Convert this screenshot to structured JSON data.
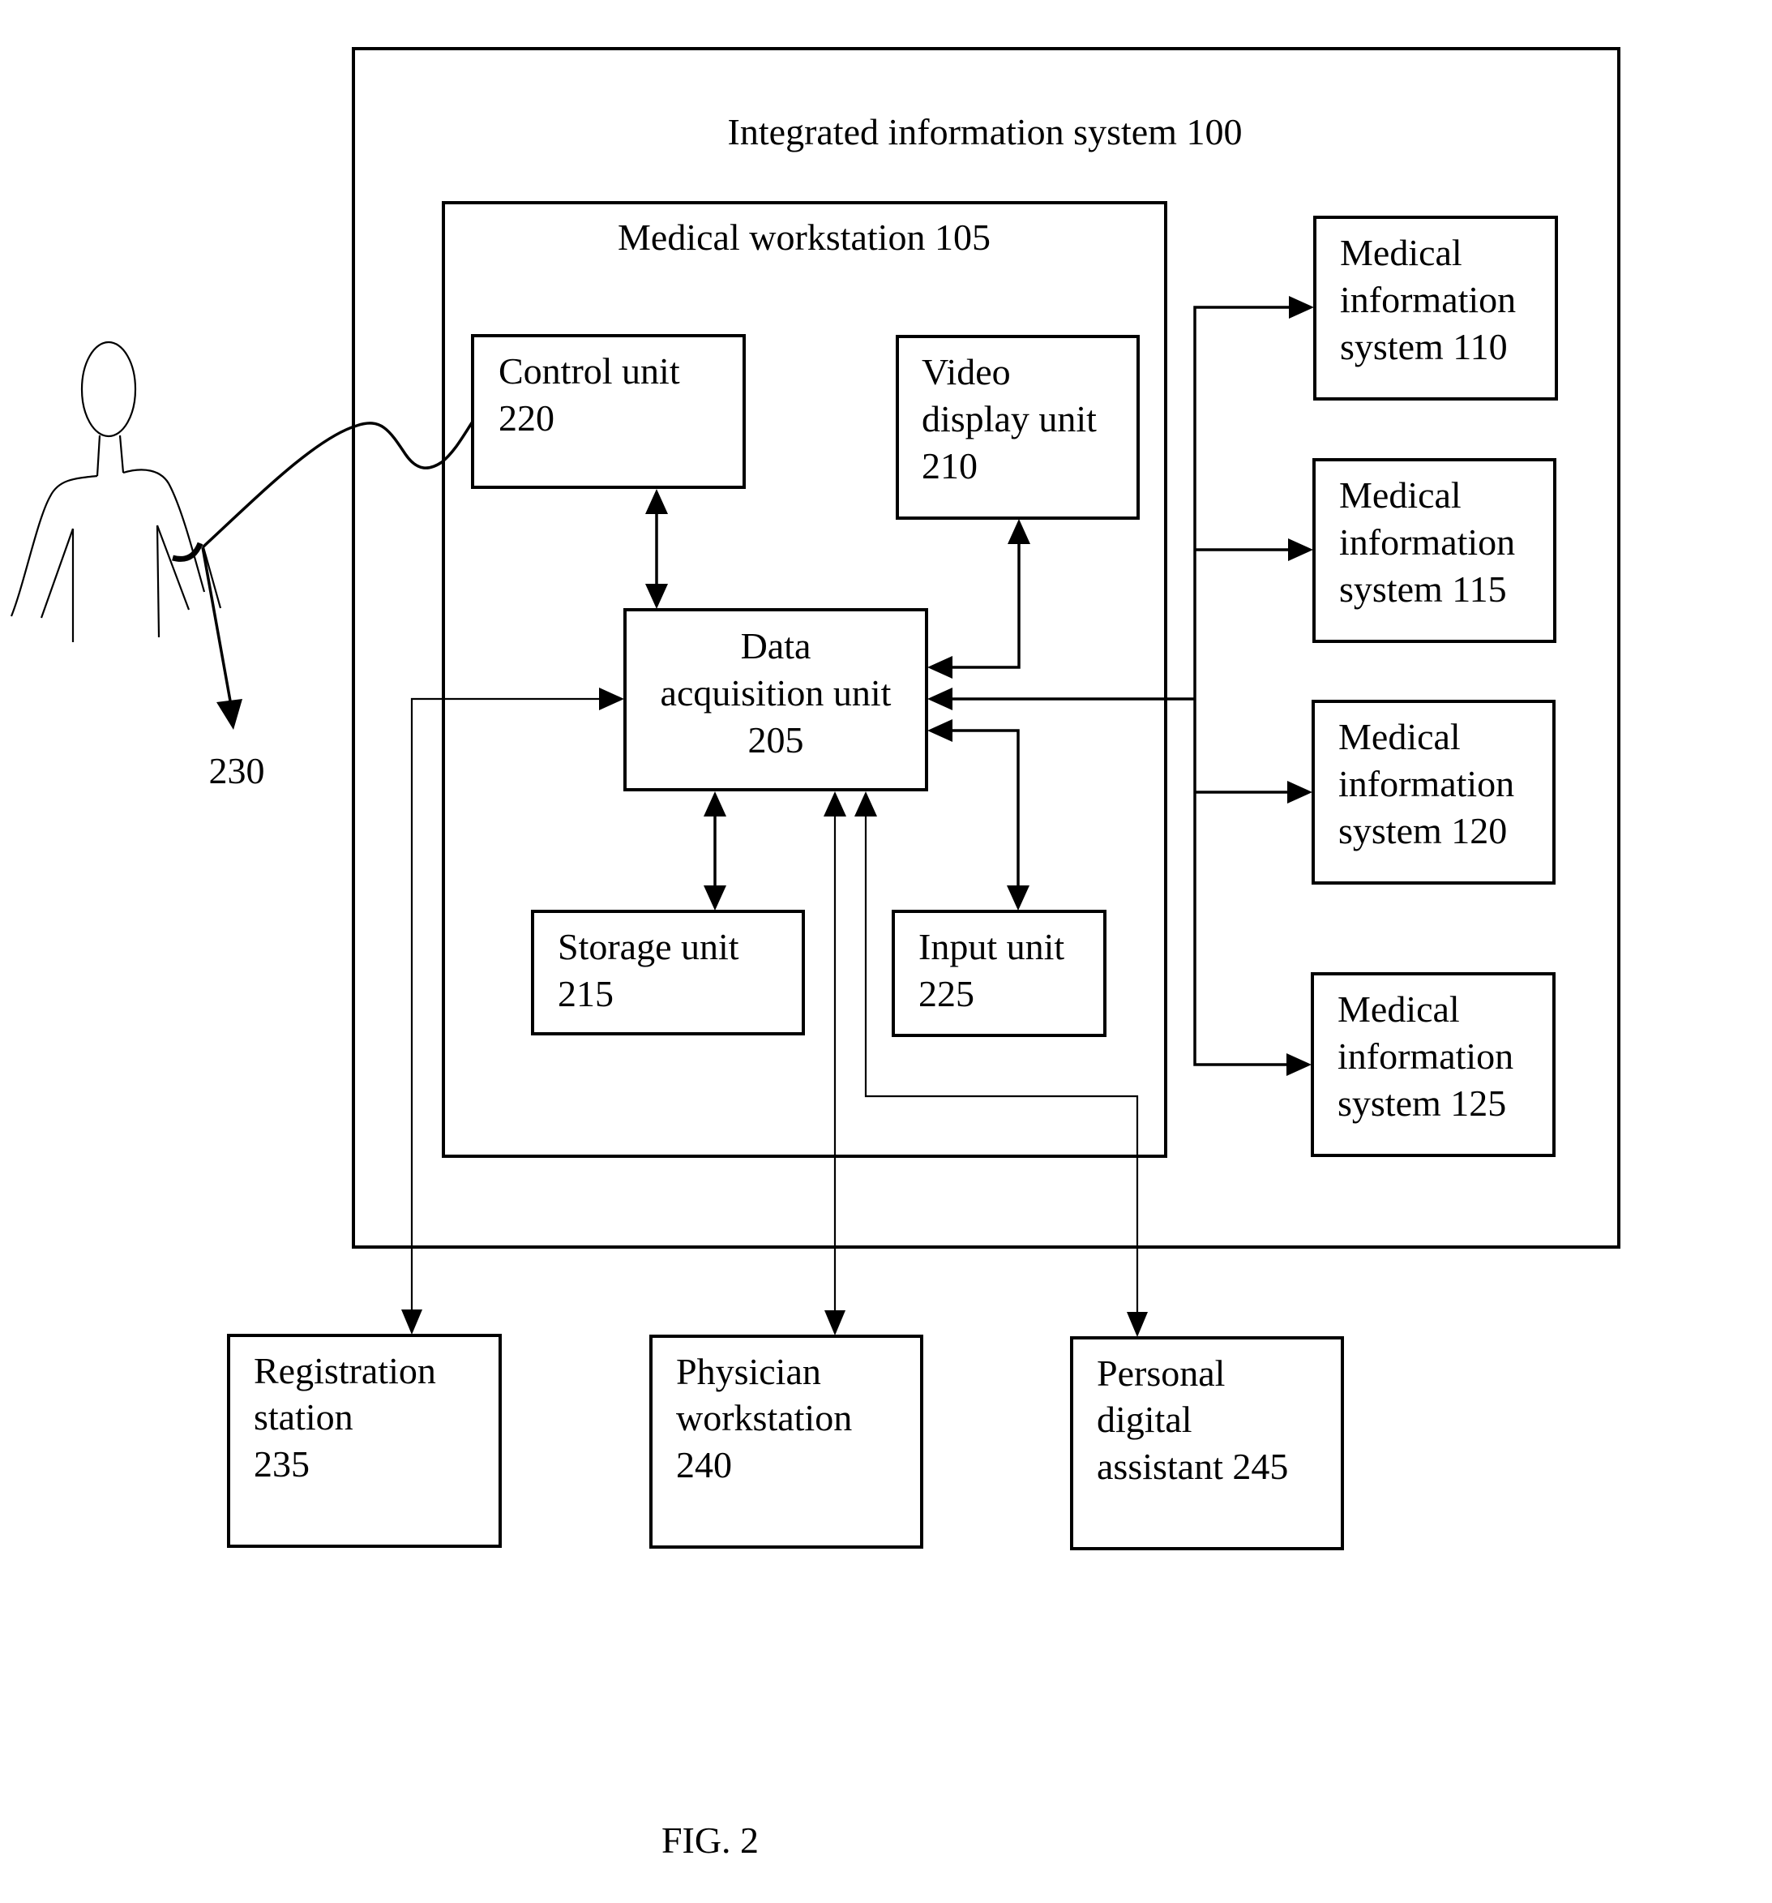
{
  "figure_caption": "FIG. 2",
  "containers": {
    "integrated_system": {
      "label": "Integrated information system 100"
    },
    "medical_workstation": {
      "label": "Medical workstation 105"
    }
  },
  "units": {
    "control": {
      "lines": [
        "Control unit",
        "220"
      ]
    },
    "video": {
      "lines": [
        "Video",
        "display unit",
        "210"
      ]
    },
    "dau": {
      "lines": [
        "Data",
        "acquisition unit",
        "205"
      ]
    },
    "storage": {
      "lines": [
        "Storage unit",
        "215"
      ]
    },
    "input": {
      "lines": [
        "Input unit",
        "225"
      ]
    }
  },
  "information_systems": [
    {
      "lines": [
        "Medical",
        "information",
        "system 110"
      ]
    },
    {
      "lines": [
        "Medical",
        "information",
        "system 115"
      ]
    },
    {
      "lines": [
        "Medical",
        "information",
        "system 120"
      ]
    },
    {
      "lines": [
        "Medical",
        "information",
        "system 125"
      ]
    }
  ],
  "external": [
    {
      "lines": [
        "Registration",
        "station",
        "235"
      ]
    },
    {
      "lines": [
        "Physician",
        "workstation",
        "240"
      ]
    },
    {
      "lines": [
        "Personal",
        "digital",
        "assistant 245"
      ]
    }
  ],
  "patient": {
    "cuff_label": "230"
  }
}
